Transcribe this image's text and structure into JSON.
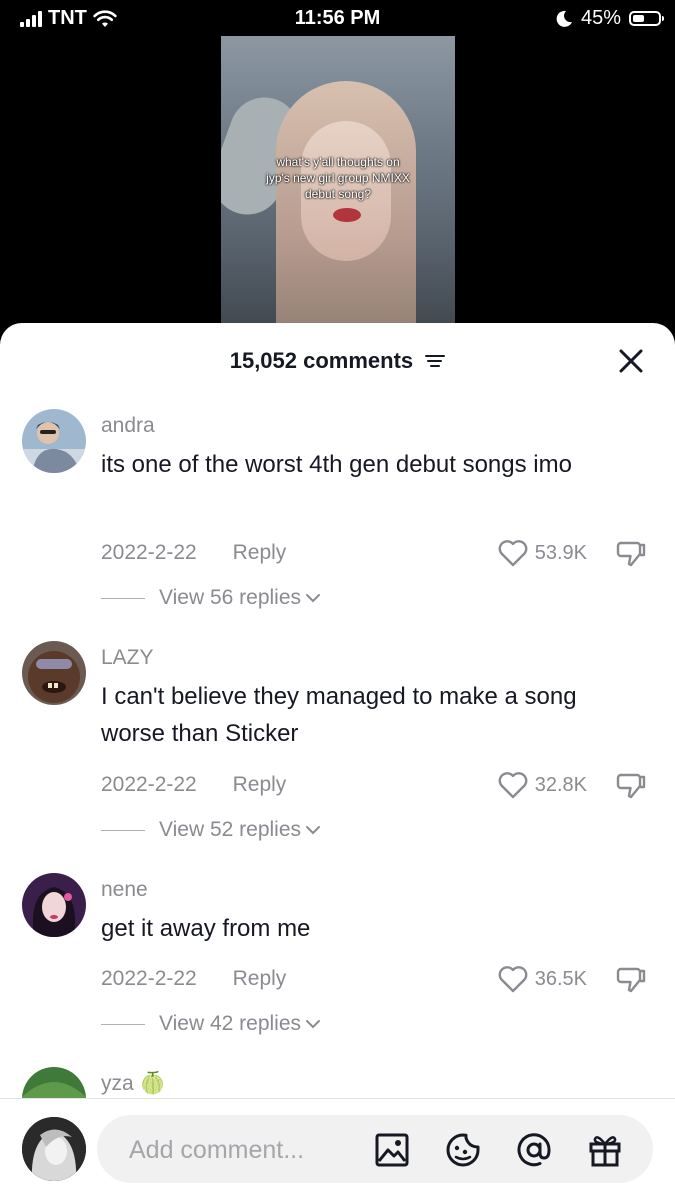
{
  "status_bar": {
    "carrier": "TNT",
    "time": "11:56 PM",
    "battery": "45%",
    "battery_level": 0.45
  },
  "video": {
    "caption_lines": [
      "what's y'all thoughts on",
      "jyp's new girl group NMIXX",
      "debut song?"
    ]
  },
  "comments_header": {
    "count_label": "15,052 comments",
    "filter_icon": "filter-icon",
    "close_icon": "close-icon"
  },
  "comments": [
    {
      "username": "andra",
      "text": "its one of the worst 4th gen debut songs imo",
      "date": "2022-2-22",
      "reply_label": "Reply",
      "likes": "53.9K",
      "view_replies": "View 56 replies"
    },
    {
      "username": "LAZY",
      "text": "I can't believe they managed to make a song worse than Sticker",
      "date": "2022-2-22",
      "reply_label": "Reply",
      "likes": "32.8K",
      "view_replies": "View 52 replies"
    },
    {
      "username": "nene",
      "text": "get it away from me",
      "date": "2022-2-22",
      "reply_label": "Reply",
      "likes": "36.5K",
      "view_replies": "View 42 replies"
    },
    {
      "username": "yza",
      "emoji": "🍈"
    }
  ],
  "bottom_bar": {
    "placeholder": "Add comment...",
    "icons": [
      "image-icon",
      "emoji-icon",
      "mention-icon",
      "gift-icon"
    ]
  },
  "colors": {
    "text": "#161823",
    "muted": "#8a8b91",
    "input_bg": "#f1f1f2"
  }
}
